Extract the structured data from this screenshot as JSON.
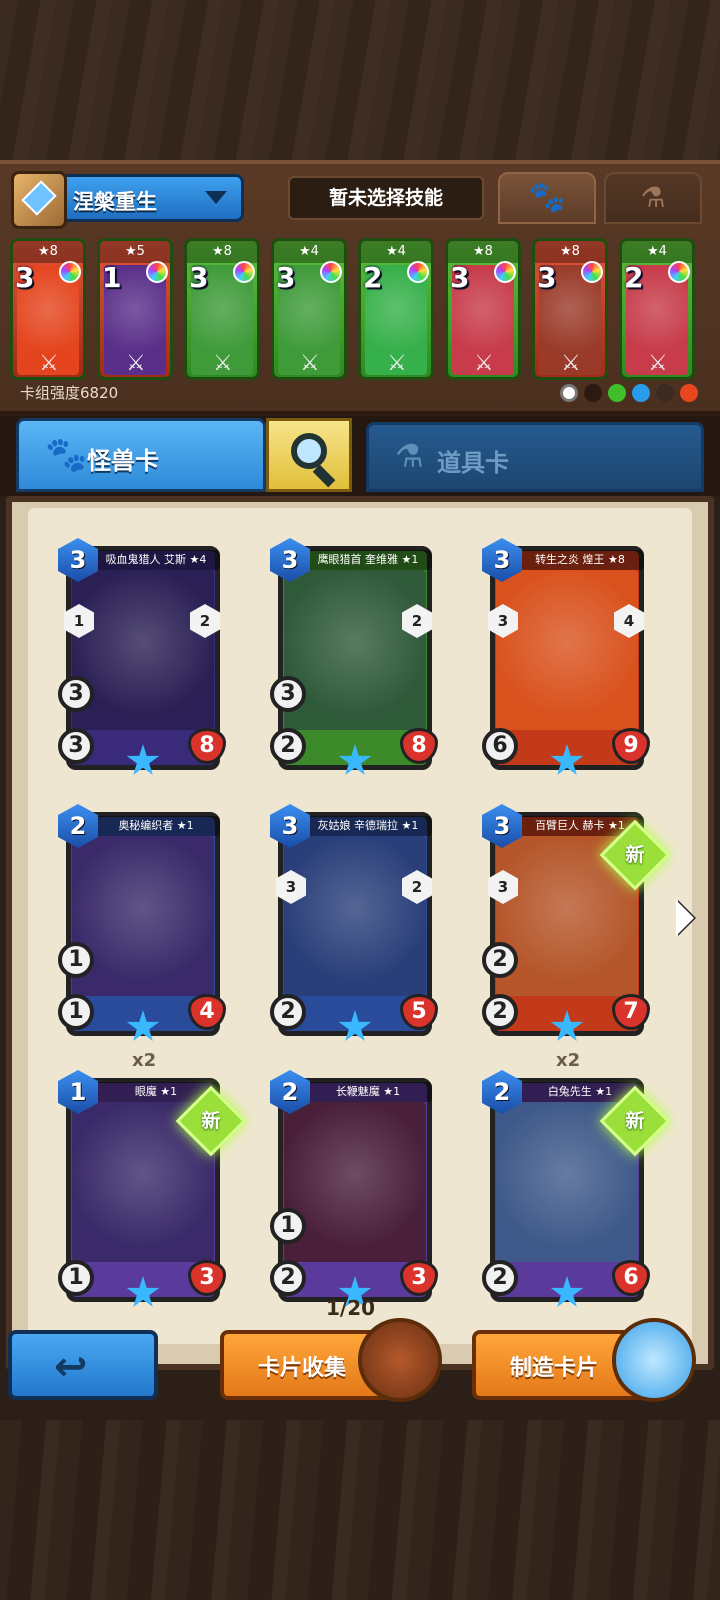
{
  "deck": {
    "name": "涅槃重生",
    "skill_status": "暂未选择技能",
    "power_label": "卡组强度6820",
    "tab_paw": "🐾",
    "tab_potion": "⚗",
    "cards": [
      {
        "stars": "★8",
        "cost": "3",
        "color": "#e4451e",
        "frame": "#b22a16"
      },
      {
        "stars": "★5",
        "cost": "1",
        "color": "#5a2f8a",
        "frame": "#a33a1a"
      },
      {
        "stars": "★8",
        "cost": "3",
        "color": "#3f9b3a",
        "frame": "#2a6b22"
      },
      {
        "stars": "★4",
        "cost": "3",
        "color": "#3f9b3a",
        "frame": "#2a6b22"
      },
      {
        "stars": "★4",
        "cost": "2",
        "color": "#36b04a",
        "frame": "#2a6b22"
      },
      {
        "stars": "★8",
        "cost": "3",
        "color": "#c73b4a",
        "frame": "#2a6b22"
      },
      {
        "stars": "★8",
        "cost": "3",
        "color": "#9a3b2a",
        "frame": "#a33a1a"
      },
      {
        "stars": "★4",
        "cost": "2",
        "color": "#c73b4a",
        "frame": "#2a6b22"
      }
    ]
  },
  "tabs": {
    "monster": "怪兽卡",
    "item": "道具卡"
  },
  "collection": {
    "pager": "1/20",
    "cards": [
      {
        "title": "吸血鬼猎人 艾斯 ★4",
        "cost": "3",
        "atk": "3",
        "hp": "8",
        "shield": "3",
        "left1": "1",
        "right1": "2",
        "frame": "#3a2a7a",
        "art": "#2b2055",
        "new": "",
        "count": ""
      },
      {
        "title": "鹰眼猎首 奎维雅 ★1",
        "cost": "3",
        "atk": "2",
        "hp": "8",
        "shield": "3",
        "left1": "",
        "right1": "2",
        "frame": "#3d8a2a",
        "art": "#2f5a3a",
        "new": "",
        "count": ""
      },
      {
        "title": "转生之炎 煌王 ★8",
        "cost": "3",
        "atk": "6",
        "hp": "9",
        "shield": "",
        "left1": "3",
        "right1": "4",
        "frame": "#c33a1a",
        "art": "#d9521e",
        "new": "",
        "count": ""
      },
      {
        "title": "奥秘编织者 ★1",
        "cost": "2",
        "atk": "1",
        "hp": "4",
        "shield": "1",
        "left1": "",
        "right1": "",
        "frame": "#2a4a9a",
        "art": "#3a2a6a",
        "new": "",
        "count": ""
      },
      {
        "title": "灰姑娘 辛德瑞拉 ★1",
        "cost": "3",
        "atk": "2",
        "hp": "5",
        "shield": "",
        "left1": "3",
        "right1": "2",
        "frame": "#2a4a9a",
        "art": "#2a3f7a",
        "new": "",
        "count": ""
      },
      {
        "title": "百臂巨人 赫卡 ★1",
        "cost": "3",
        "atk": "2",
        "hp": "7",
        "shield": "2",
        "left1": "3",
        "right1": "",
        "frame": "#c33a1a",
        "art": "#b5562a",
        "new": "新",
        "count": ""
      },
      {
        "title": "眼魔 ★1",
        "cost": "1",
        "atk": "1",
        "hp": "3",
        "shield": "",
        "left1": "",
        "right1": "",
        "frame": "#5a3a9a",
        "art": "#3a2a6a",
        "new": "新",
        "count": "x2"
      },
      {
        "title": "长鞭魅魔 ★1",
        "cost": "2",
        "atk": "2",
        "hp": "3",
        "shield": "1",
        "left1": "",
        "right1": "",
        "frame": "#5a3a9a",
        "art": "#4a1f3a",
        "new": "",
        "count": ""
      },
      {
        "title": "白兔先生 ★1",
        "cost": "2",
        "atk": "2",
        "hp": "6",
        "shield": "",
        "left1": "",
        "right1": "",
        "frame": "#5a3a9a",
        "art": "#3f5a8a",
        "new": "新",
        "count": "x2"
      }
    ]
  },
  "bottom": {
    "back_icon": "↩",
    "collect_label": "卡片收集",
    "craft_label": "制造卡片"
  }
}
